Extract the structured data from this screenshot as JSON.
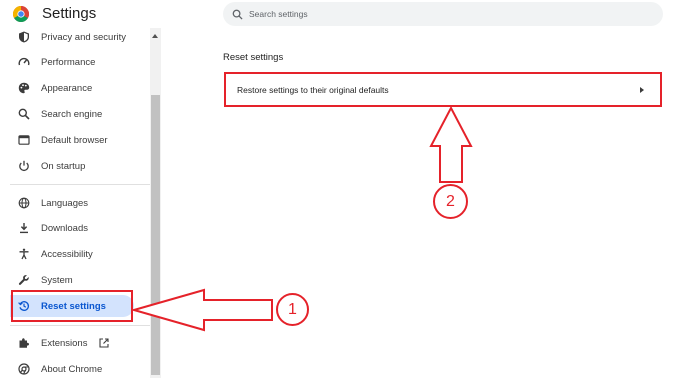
{
  "header": {
    "title": "Settings",
    "logo_icon": "chrome-logo-icon"
  },
  "search": {
    "placeholder": "Search settings"
  },
  "sidebar": {
    "items": [
      {
        "label": "Privacy and security",
        "icon": "shield-icon"
      },
      {
        "label": "Performance",
        "icon": "gauge-icon"
      },
      {
        "label": "Appearance",
        "icon": "palette-icon"
      },
      {
        "label": "Search engine",
        "icon": "search-icon"
      },
      {
        "label": "Default browser",
        "icon": "browser-window-icon"
      },
      {
        "label": "On startup",
        "icon": "power-icon"
      },
      {
        "label": "Languages",
        "icon": "globe-icon"
      },
      {
        "label": "Downloads",
        "icon": "download-icon"
      },
      {
        "label": "Accessibility",
        "icon": "accessibility-icon"
      },
      {
        "label": "System",
        "icon": "wrench-icon"
      },
      {
        "label": "Reset settings",
        "icon": "reset-history-icon",
        "selected": true
      },
      {
        "label": "Extensions",
        "icon": "puzzle-icon",
        "external": true
      },
      {
        "label": "About Chrome",
        "icon": "chrome-outline-icon"
      }
    ]
  },
  "main": {
    "section_title": "Reset settings",
    "row_label": "Restore settings to their original defaults"
  },
  "annotations": {
    "step1": "1",
    "step2": "2",
    "color": "#e5222a"
  },
  "colors": {
    "accent": "#0b57d0",
    "selected_bg": "#d3e3fd",
    "annotation": "#e5222a"
  }
}
